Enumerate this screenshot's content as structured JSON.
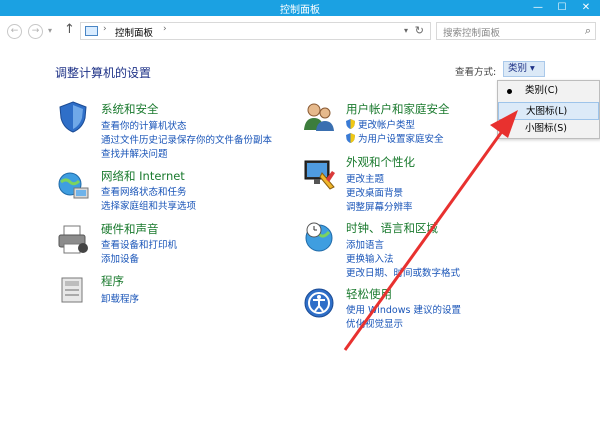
{
  "window": {
    "title": "控制面板",
    "minimize": "—",
    "maximize": "☐",
    "close": "✕"
  },
  "address": {
    "crumb": "控制面板",
    "sep1": "›",
    "sep2": "›",
    "search_placeholder": "搜索控制面板"
  },
  "page": {
    "heading": "调整计算机的设置",
    "view_by_label": "查看方式:",
    "view_by_value": "类别 ▾"
  },
  "view_menu": {
    "items": [
      "类别(C)",
      "大图标(L)",
      "小图标(S)"
    ],
    "selected_index": 0,
    "highlighted_index": 1
  },
  "categories": [
    {
      "title": "系统和安全",
      "links": [
        "查看你的计算机状态",
        "通过文件历史记录保存你的文件备份副本",
        "查找并解决问题"
      ]
    },
    {
      "title": "网络和 Internet",
      "links": [
        "查看网络状态和任务",
        "选择家庭组和共享选项"
      ]
    },
    {
      "title": "硬件和声音",
      "links": [
        "查看设备和打印机",
        "添加设备"
      ]
    },
    {
      "title": "程序",
      "links": [
        "卸载程序"
      ]
    },
    {
      "title": "用户帐户和家庭安全",
      "links": [
        "更改帐户类型",
        "为用户设置家庭安全"
      ]
    },
    {
      "title": "外观和个性化",
      "links": [
        "更改主题",
        "更改桌面背景",
        "调整屏幕分辨率"
      ]
    },
    {
      "title": "时钟、语言和区域",
      "links": [
        "添加语言",
        "更换输入法",
        "更改日期、时间或数字格式"
      ]
    },
    {
      "title": "轻松使用",
      "links": [
        "使用 Windows 建议的设置",
        "优化视觉显示"
      ]
    }
  ],
  "colors": {
    "titlebar": "#1ba1e2",
    "heading": "#1e3287",
    "category_title": "#1a7a2e",
    "link": "#1a55b8",
    "arrow": "#e8312f"
  }
}
